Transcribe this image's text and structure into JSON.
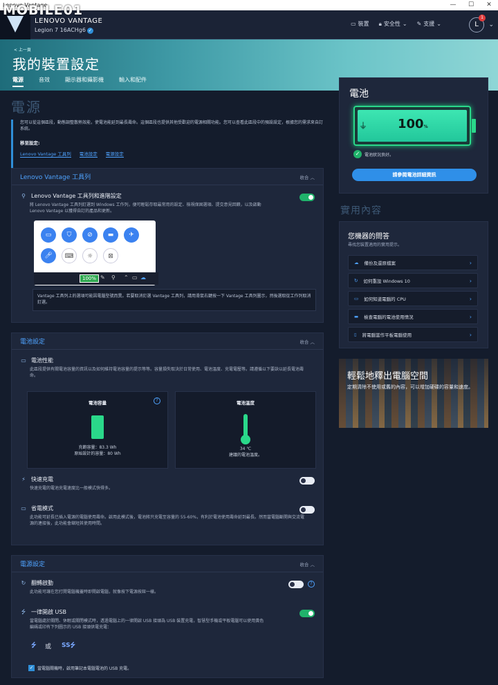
{
  "window": {
    "title": "Lenovo Vantage",
    "controls": [
      "—",
      "☐",
      "✕"
    ]
  },
  "watermark": "MOBILE01",
  "topbar": {
    "brand": "LENOVO VANTAGE",
    "model": "Legion 7 16ACHg6",
    "nav": [
      {
        "label": "裝置",
        "icon": "monitor-icon"
      },
      {
        "label": "安全性",
        "icon": "lock-icon"
      },
      {
        "label": "支援",
        "icon": "wrench-icon"
      }
    ],
    "avatar": "L",
    "badge": "1"
  },
  "hero": {
    "back": "< 上一頁",
    "title": "我的裝置設定",
    "tabs": [
      "電源",
      "音效",
      "顯示器和攝影機",
      "輸入和配件"
    ],
    "active_tab": 0
  },
  "page": {
    "heading": "電源",
    "intro": "您可以從這個區段，動態調整散熱效能，使電池能延到最長壽命。這個區段也提供其他受歡迎的電源相關功能。您可以查看此區段中的預設設定，根據您的需求來自訂系統。",
    "jump_label": "移至設定:",
    "jump_links": [
      "Lenovo Vantage 工具列",
      "電池設定",
      "電源設定"
    ]
  },
  "toolbar_card": {
    "title": "Lenovo Vantage 工具列",
    "collapse": "收合",
    "row_title": "Lenovo Vantage 工具列和進階設定",
    "row_desc": "將 Lenovo Vantage 工具列釘選到 Windows 工作列，便可輕鬆存取最常用的設定、檢視保固選項、提交意見回饋，以及啟動 Lenovo Vantage 以獲得自訂的產品和更新。",
    "toggle": true,
    "preview_battery": "100%",
    "notice": "Vantage 工具列上的選項可能因電腦型號而異。若要取消釘選 Vantage 工具列，請用滑鼠右鍵按一下 Vantage 工具列圖示，然後選取從工作列取消釘選。"
  },
  "battery_card": {
    "title": "電池設定",
    "collapse": "收合",
    "perf_title": "電池性能",
    "perf_desc": "此區段提供有關電池容量的資訊以及如何維持電池容量的提示等等。容量損失取決於日常使用、電池溫度、充電電壓等。請遵循以下要訣以延長電池壽命。",
    "capacity_label": "電池容量",
    "capacity_full": "充飽容量：83.3 Wh",
    "capacity_design": "原始設計的容量：80 Wh",
    "temp_label": "電池溫度",
    "temp_value": "34 ℃",
    "temp_note": "建議的電池溫度。",
    "quick_title": "快速充電",
    "quick_desc": "快速充電的電池充電速度比一般模式快得多。",
    "quick_on": false,
    "saver_title": "省電模式",
    "saver_desc": "此功能可延長已插入電源的電腦使用壽命。啟用此模式後，電池將只充電至容量的 55-60%，有利於電池使用壽命延到最長。然而當電腦斷開與交流電源的連接後，此功能會縮短其使用時間。",
    "saver_on": false
  },
  "power_card": {
    "title": "電源設定",
    "collapse": "收合",
    "flip_title": "翻轉啟動",
    "flip_desc": "此功能可讓在您打開電腦機蓋時即開啟電腦，就像按下電源按鈕一樣。",
    "flip_on": false,
    "usb_title": "一律開啟 USB",
    "usb_desc": "當電腦處於關閉、休眠或關閉模式時，透過電腦上的一律開啟 USB 接頭為 USB 裝置充電，智慧型手機或平板電腦可以使用黃色編碼或印有下列圖示的 USB 接頭供電充電：",
    "usb_on": true,
    "or": "或",
    "checkbox_label": "當電腦關機時，啟用筆記本電腦電池的 USB 充電。"
  },
  "battery_panel": {
    "title": "電池",
    "level": 100,
    "level_text": "100",
    "level_unit": "%",
    "status": "電池狀況良好。",
    "button": "請參閱電池詳細資訊"
  },
  "useful": {
    "heading": "實用內容",
    "title": "您機器的問答",
    "subtitle": "尋找您裝置適用的實用提示。",
    "items": [
      {
        "label": "備份及還原檔案",
        "icon": "cloud-icon"
      },
      {
        "label": "如何重設 Windows 10",
        "icon": "refresh-icon"
      },
      {
        "label": "如何知道電腦的 CPU",
        "icon": "laptop-icon"
      },
      {
        "label": "檢查電腦的電池使用情況",
        "icon": "battery-icon"
      },
      {
        "label": "將電腦當作平板電腦使用",
        "icon": "tablet-icon"
      }
    ]
  },
  "promo": {
    "title": "輕鬆地釋出電腦空間",
    "desc": "定期清除不使用或舊的內容，可以增加硬碟的容量和速度。"
  }
}
